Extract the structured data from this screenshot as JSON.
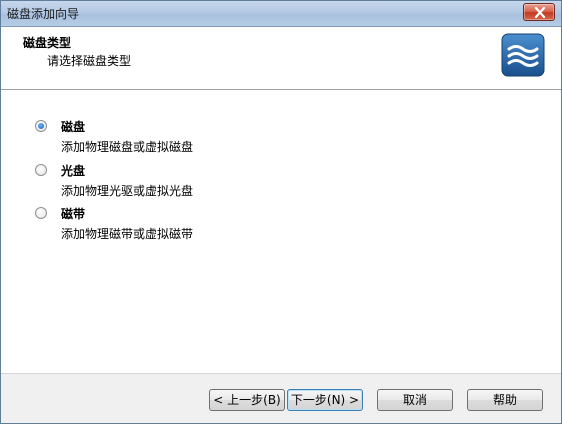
{
  "window": {
    "title": "磁盘添加向导"
  },
  "header": {
    "title": "磁盘类型",
    "subtitle": "请选择磁盘类型"
  },
  "options": [
    {
      "label": "磁盘",
      "description": "添加物理磁盘或虚拟磁盘",
      "selected": true
    },
    {
      "label": "光盘",
      "description": "添加物理光驱或虚拟光盘",
      "selected": false
    },
    {
      "label": "磁带",
      "description": "添加物理磁带或虚拟磁带",
      "selected": false
    }
  ],
  "buttons": {
    "back": "< 上一步(B)",
    "next": "下一步(N) >",
    "cancel": "取消",
    "help": "帮助"
  },
  "colors": {
    "accent": "#1f5e9e",
    "logo_bg": "#2c6fb2"
  },
  "icons": {
    "close": "close-icon",
    "logo": "waves-logo-icon"
  }
}
